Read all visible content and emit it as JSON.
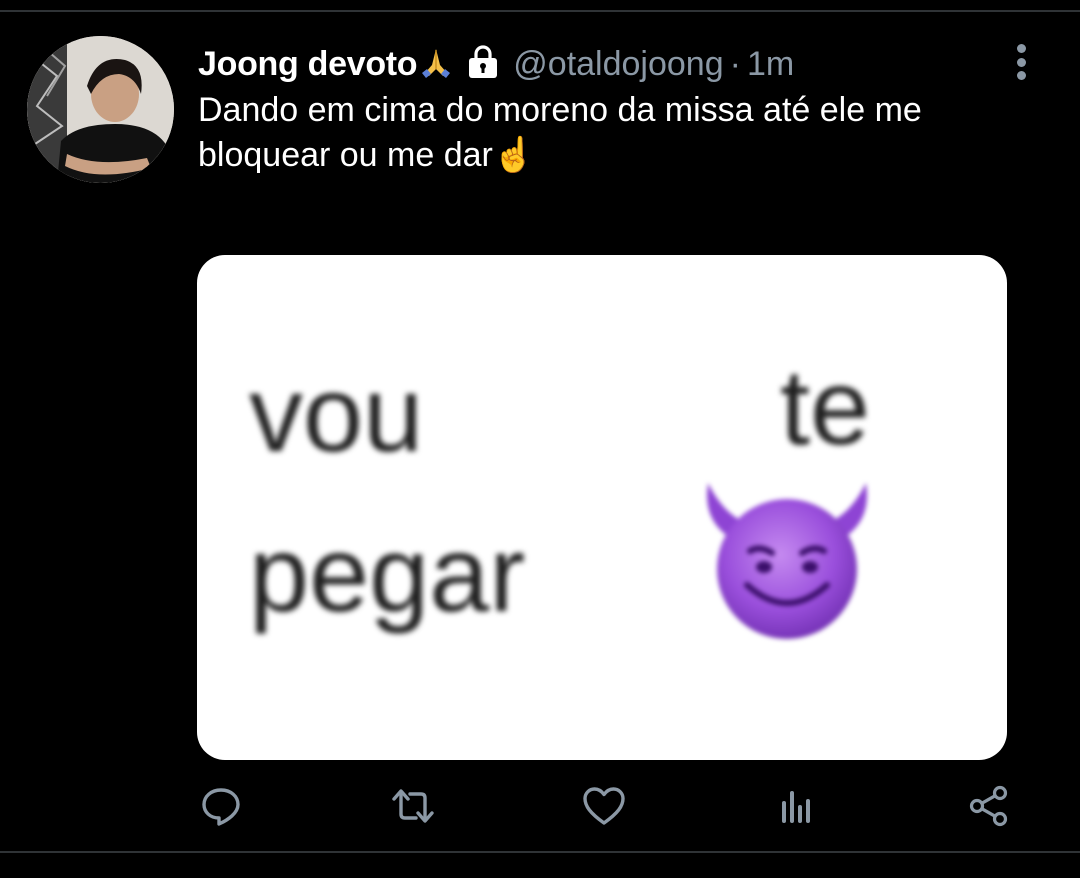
{
  "tweet": {
    "display_name": "Joong devoto",
    "name_emoji": "🙏",
    "name_emoji_icon": "folded-hands-icon",
    "lock_icon": "lock-icon",
    "handle": "@otaldojoong",
    "separator": "·",
    "time": "1m",
    "text": "Dando em cima do moreno da missa até ele me bloquear ou me dar",
    "text_emoji": "☝️",
    "media": {
      "word_1": "vou",
      "word_2": "te",
      "word_3": "pegar",
      "emoji_icon": "smiling-devil-icon"
    }
  },
  "actions": {
    "reply_icon": "reply-icon",
    "retweet_icon": "retweet-icon",
    "like_icon": "heart-icon",
    "analytics_icon": "analytics-icon",
    "share_icon": "share-icon"
  },
  "colors": {
    "background": "#000000",
    "primary_text": "#ffffff",
    "secondary_text": "#8b98a5",
    "divider": "#2f3336",
    "devil_purple": "#8a3fd1"
  }
}
